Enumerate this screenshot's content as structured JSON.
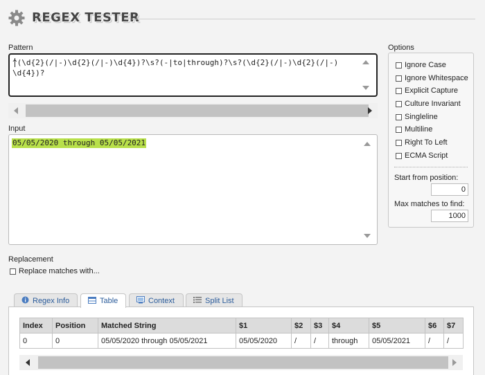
{
  "app": {
    "title": "REGEX TESTER"
  },
  "pattern": {
    "label": "Pattern",
    "value": "^(\\d{2}(/|-)\\d{2}(/|-)\\d{4})?\\s?(-|to|through)?\\s?(\\d{2}(/|-)\\d{2}(/|-)\\d{4})?"
  },
  "input": {
    "label": "Input",
    "value": "05/05/2020 through 05/05/2021"
  },
  "options": {
    "label": "Options",
    "items": [
      {
        "label": "Ignore Case",
        "checked": false
      },
      {
        "label": "Ignore Whitespace",
        "checked": false
      },
      {
        "label": "Explicit Capture",
        "checked": false
      },
      {
        "label": "Culture Invariant",
        "checked": false
      },
      {
        "label": "Singleline",
        "checked": false
      },
      {
        "label": "Multiline",
        "checked": false
      },
      {
        "label": "Right To Left",
        "checked": false
      },
      {
        "label": "ECMA Script",
        "checked": false
      }
    ],
    "start_label": "Start from position:",
    "start_value": "0",
    "max_label": "Max matches to find:",
    "max_value": "1000"
  },
  "replacement": {
    "label": "Replacement",
    "checkbox_label": "Replace matches with...",
    "checked": false
  },
  "tabs": [
    {
      "label": "Regex Info",
      "icon": "info-icon",
      "active": false
    },
    {
      "label": "Table",
      "icon": "table-icon",
      "active": true
    },
    {
      "label": "Context",
      "icon": "context-icon",
      "active": false
    },
    {
      "label": "Split List",
      "icon": "list-icon",
      "active": false
    }
  ],
  "results": {
    "columns": [
      "Index",
      "Position",
      "Matched String",
      "$1",
      "$2",
      "$3",
      "$4",
      "$5",
      "$6",
      "$7"
    ],
    "rows": [
      [
        "0",
        "0",
        "05/05/2020 through 05/05/2021",
        "05/05/2020",
        "/",
        "/",
        "through",
        "05/05/2021",
        "/",
        "/"
      ]
    ]
  },
  "colors": {
    "match_highlight": "#b8e04a",
    "tab_text": "#2a5b9a",
    "table_header_bg": "#dcdcdc"
  }
}
